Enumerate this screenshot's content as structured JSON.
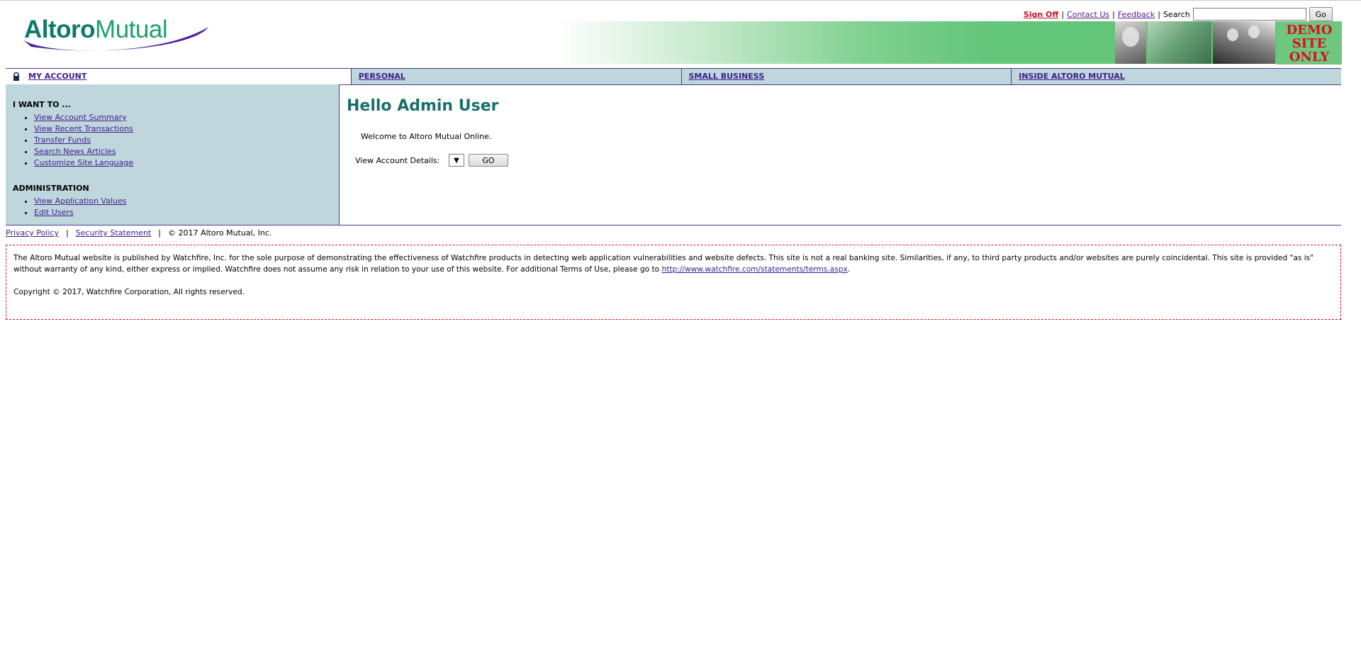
{
  "header": {
    "logo_altoro": "Altoro",
    "logo_mutual": "Mutual",
    "utility": {
      "sign_off": "Sign Off",
      "contact_us": "Contact Us",
      "feedback": "Feedback",
      "search_label": "Search",
      "search_value": "",
      "go_button": "Go"
    },
    "demo_lines": [
      "DEMO",
      "SITE",
      "ONLY"
    ]
  },
  "nav": {
    "tabs": [
      {
        "label": "MY ACCOUNT",
        "icon": "lock-icon"
      },
      {
        "label": "PERSONAL"
      },
      {
        "label": "SMALL BUSINESS"
      },
      {
        "label": "INSIDE ALTORO MUTUAL"
      }
    ]
  },
  "sidebar": {
    "i_want_heading": "I WANT TO ...",
    "i_want_items": [
      "View Account Summary",
      "View Recent Transactions",
      "Transfer Funds",
      "Search News Articles",
      "Customize Site Language"
    ],
    "admin_heading": "ADMINISTRATION",
    "admin_items": [
      "View Application Values",
      "Edit Users"
    ]
  },
  "main": {
    "greeting": "Hello Admin User",
    "welcome": "Welcome to Altoro Mutual Online.",
    "details_label": "View Account Details:",
    "select_value": "",
    "go_button": "GO"
  },
  "footer": {
    "privacy": "Privacy Policy",
    "security": "Security Statement",
    "copyright": "© 2017 Altoro Mutual, Inc.",
    "separator": "|",
    "disclaimer_text": "The Altoro Mutual website is published by Watchfire, Inc. for the sole purpose of demonstrating the effectiveness of Watchfire products in detecting web application vulnerabilities and website defects. This site is not a real banking site. Similarities, if any, to third party products and/or websites are purely coincidental. This site is provided \"as is\" without warranty of any kind, either express or implied. Watchfire does not assume any risk in relation to your use of this website. For additional Terms of Use, please go to ",
    "terms_link": "http://www.watchfire.com/statements/terms.aspx",
    "disclaimer_end": ".",
    "watchfire_copyright": "Copyright © 2017, Watchfire Corporation, All rights reserved."
  },
  "colors": {
    "brand_teal": "#1a6f6a",
    "nav_bg": "#bfd7dc",
    "nav_border": "#4a3c8c",
    "signoff_red": "#c8102e",
    "banner_green": "#63c57a",
    "demo_red": "#d8111a"
  }
}
